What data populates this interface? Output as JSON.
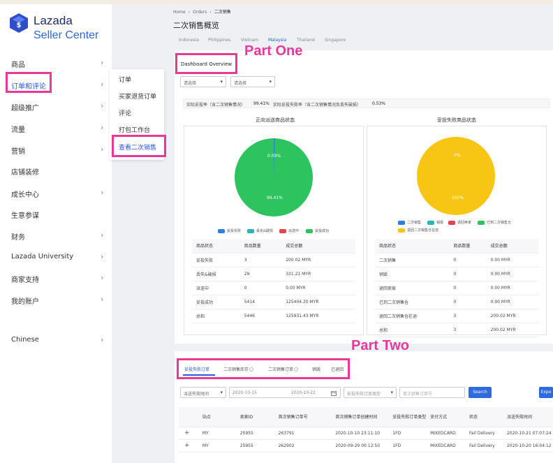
{
  "brand": {
    "line1": "Lazada",
    "line2": "Seller Center"
  },
  "menu": [
    {
      "label": "商品",
      "chevron": true
    },
    {
      "label": "订单和评论",
      "chevron": true
    },
    {
      "label": "超级推广",
      "chevron": true
    },
    {
      "label": "流量",
      "chevron": true
    },
    {
      "label": "营销",
      "chevron": true
    },
    {
      "label": "店铺装修",
      "chevron": false
    },
    {
      "label": "成长中心",
      "chevron": true
    },
    {
      "label": "生意参谋",
      "chevron": false
    },
    {
      "label": "财务",
      "chevron": true
    },
    {
      "label": "Lazada University",
      "chevron": true
    },
    {
      "label": "商家支持",
      "chevron": true
    },
    {
      "label": "我的账户",
      "chevron": true
    },
    {
      "label": "Chinese",
      "chevron": true
    }
  ],
  "submenu": [
    "订单",
    "买家退货订单",
    "评论",
    "打包工作台",
    "查看二次销售"
  ],
  "breadcrumb": [
    "Home",
    "›",
    "Orders",
    "›",
    "二次销售"
  ],
  "page_title": "二次销售概览",
  "country_tabs": [
    "Indonesia",
    "Philippines",
    "Vietnam",
    "Malaysia",
    "Thailand",
    "Singapore"
  ],
  "annotations": {
    "part_one": "Part One",
    "part_two": "Part Two"
  },
  "dashboard_tab": "Dashboard Overview",
  "filters": {
    "select1": "请选择",
    "select2": "请选择"
  },
  "rates": {
    "label1": "实际妥投率（含二次销售情况）",
    "value1": "99.41%",
    "label2": "实际妥投失败率（含二次销售情况及丢失破损）",
    "value2": "0.53%"
  },
  "left_panel": {
    "title": "正向派送商品状态",
    "pie_labels": [
      "0.09%",
      "99.41%"
    ],
    "legend": [
      "妥投失败",
      "丢失&破损",
      "派送中",
      "妥投成功"
    ],
    "columns": [
      "商品状态",
      "商品数量",
      "成交总额"
    ],
    "rows": [
      [
        "妥投失败",
        "3",
        "200.02 MYR"
      ],
      [
        "丢失&破损",
        "29",
        "331.21 MYR"
      ],
      [
        "派送中",
        "0",
        "0.00 MYR"
      ],
      [
        "妥投成功",
        "5414",
        "125404.20 MYR"
      ],
      [
        "总和",
        "5446",
        "125931.43 MYR"
      ]
    ]
  },
  "right_panel": {
    "title": "妥投失败商品状态",
    "pie_labels": [
      "0%",
      "100%"
    ],
    "legend": [
      "二次销售",
      "销毁",
      "退回卖家",
      "已到二次销售仓",
      "退回二次销售仓在途"
    ],
    "columns": [
      "商品状态",
      "商品数量",
      "成交总额"
    ],
    "rows": [
      [
        "二次销售",
        "0",
        "0.00 MYR"
      ],
      [
        "销毁",
        "0",
        "0.00 MYR"
      ],
      [
        "退回卖家",
        "0",
        "0.00 MYR"
      ],
      [
        "已到二次销售仓",
        "0",
        "0.00 MYR"
      ],
      [
        "退回二次销售仓在途",
        "3",
        "200.02 MYR"
      ],
      [
        "总和",
        "3",
        "200.02 MYR"
      ]
    ]
  },
  "sub_tabs": [
    {
      "label": "妥投失败订单",
      "badge": ""
    },
    {
      "label": "二次销售库存",
      "badge": "i"
    },
    {
      "label": "二次销售订单",
      "badge": "i"
    },
    {
      "label": "销毁",
      "badge": ""
    },
    {
      "label": "已退回",
      "badge": ""
    }
  ],
  "search": {
    "time_select": "派送失败时间",
    "date_from": "2020-10-15",
    "date_to": "2020-10-22",
    "type_placeholder": "妥投失败订单类型",
    "order_placeholder": "首次销售订单号",
    "search_btn": "Search",
    "export_btn": "Expo"
  },
  "order_table": {
    "columns": [
      "",
      "站点",
      "卖家ID",
      "首次销售订单号",
      "首次销售订单创建时间",
      "妥投失败订单类型",
      "支付方式",
      "状态",
      "派送失败时间"
    ],
    "rows": [
      [
        "+",
        "MY",
        "25955",
        "263791",
        "2020-10-10 23:11:10",
        "1FD",
        "MIXEDCARD",
        "Fail Delivery",
        "2020-10-21 07:07:24"
      ],
      [
        "+",
        "MY",
        "25955",
        "262902",
        "2020-09-29 00:12:50",
        "1FD",
        "MIXEDCARD",
        "Fail Delivery",
        "2020-10-20 16:04:12"
      ]
    ]
  },
  "colors": {
    "accent": "#2a59d6",
    "highlight": "#e8399a",
    "green": "#2dc35e",
    "yellow": "#f7c514",
    "blue": "#2f7fe0",
    "teal": "#27b5b5",
    "red": "#e8424e"
  }
}
